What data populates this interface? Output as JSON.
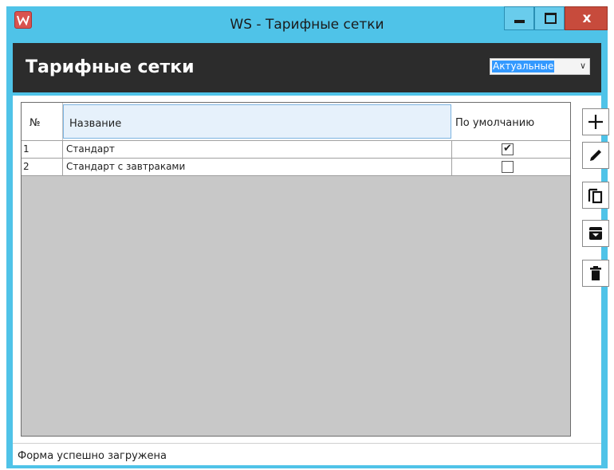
{
  "window": {
    "title": "WS - Тарифные сетки",
    "minimize_label": "",
    "maximize_label": "",
    "close_label": "x"
  },
  "header": {
    "title": "Тарифные сетки",
    "filter_value": "Актуальные"
  },
  "table": {
    "columns": [
      "№",
      "Название",
      "По умолчанию"
    ],
    "rows": [
      {
        "num": "1",
        "name": "Стандарт",
        "default": true
      },
      {
        "num": "2",
        "name": "Стандарт с завтраками",
        "default": false
      }
    ]
  },
  "toolbar": {
    "icons": [
      "plus-icon",
      "pencil-icon",
      "copy-icon",
      "archive-icon",
      "trash-icon"
    ]
  },
  "status": {
    "text": "Форма успешно загружена"
  },
  "colors": {
    "titlebar": "#4fc3e8",
    "header": "#2c2c2c",
    "close": "#c74b3c",
    "selection": "#3399ff"
  }
}
